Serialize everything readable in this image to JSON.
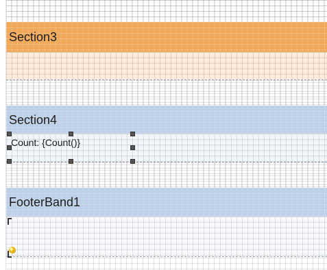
{
  "bands": {
    "section3": {
      "title": "Section3",
      "header_color": "#f0a85a",
      "body_color": "#fdebdc"
    },
    "section4": {
      "title": "Section4",
      "header_color": "#bed0e8",
      "body_color": "#f2f6fb"
    },
    "footer": {
      "title": "FooterBand1",
      "header_color": "#bed0e8",
      "body_color": "#f7f9fc"
    }
  },
  "selected_textbox": {
    "text": "Count: {Count()}"
  },
  "icons": {
    "band_marker": "smiley-marker-icon"
  }
}
